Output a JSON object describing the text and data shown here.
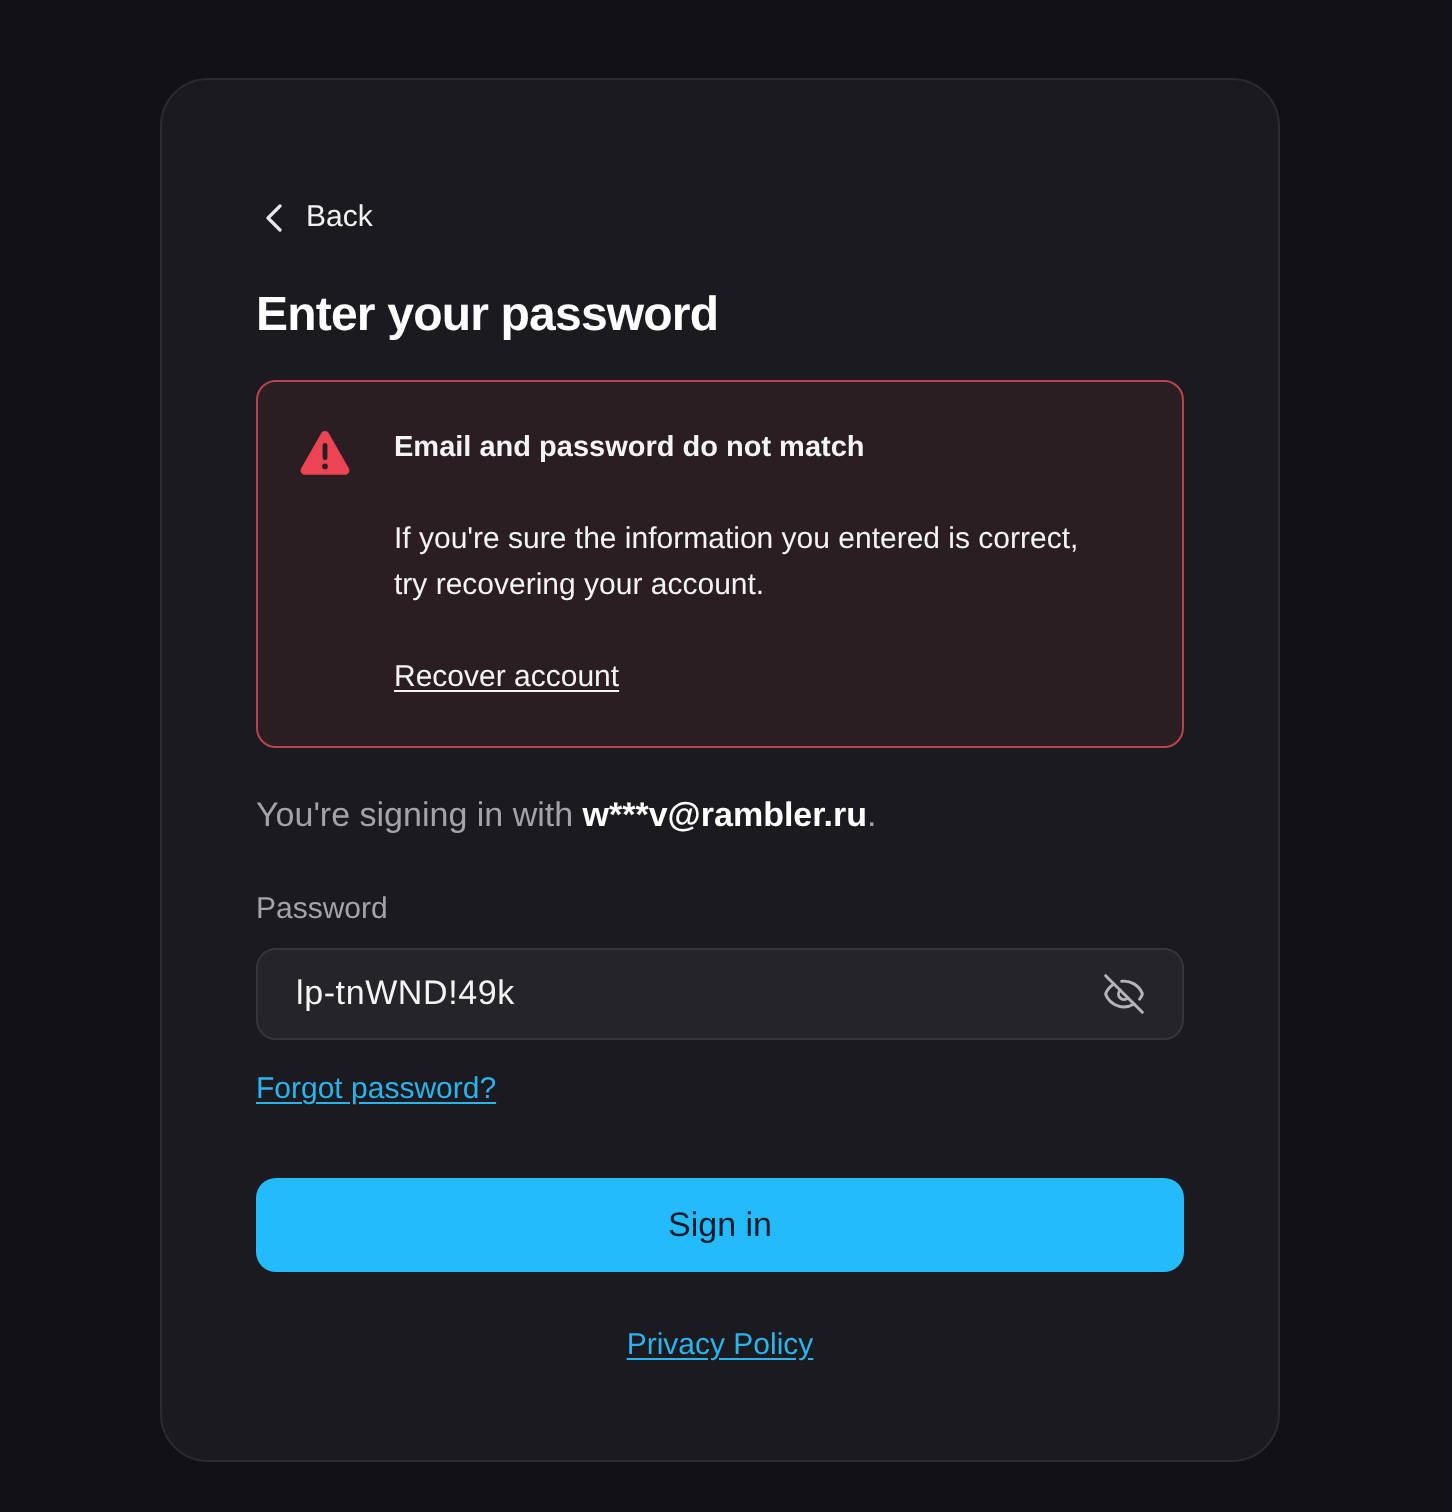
{
  "back_link": {
    "label": "Back"
  },
  "title": "Enter your password",
  "alert": {
    "kind": "error",
    "title": "Email and password do not match",
    "message": "If you're sure the information you entered is correct, try recovering your account.",
    "link": "Recover account"
  },
  "signing_in": {
    "prefix": "You're signing in with ",
    "account": "w***v@rambler.ru",
    "suffix": "."
  },
  "password": {
    "label": "Password",
    "value": "lp-tnWND!49k",
    "visible": true
  },
  "forgot_link": "Forgot password?",
  "submit": "Sign in",
  "footer_link": "Privacy Policy"
}
